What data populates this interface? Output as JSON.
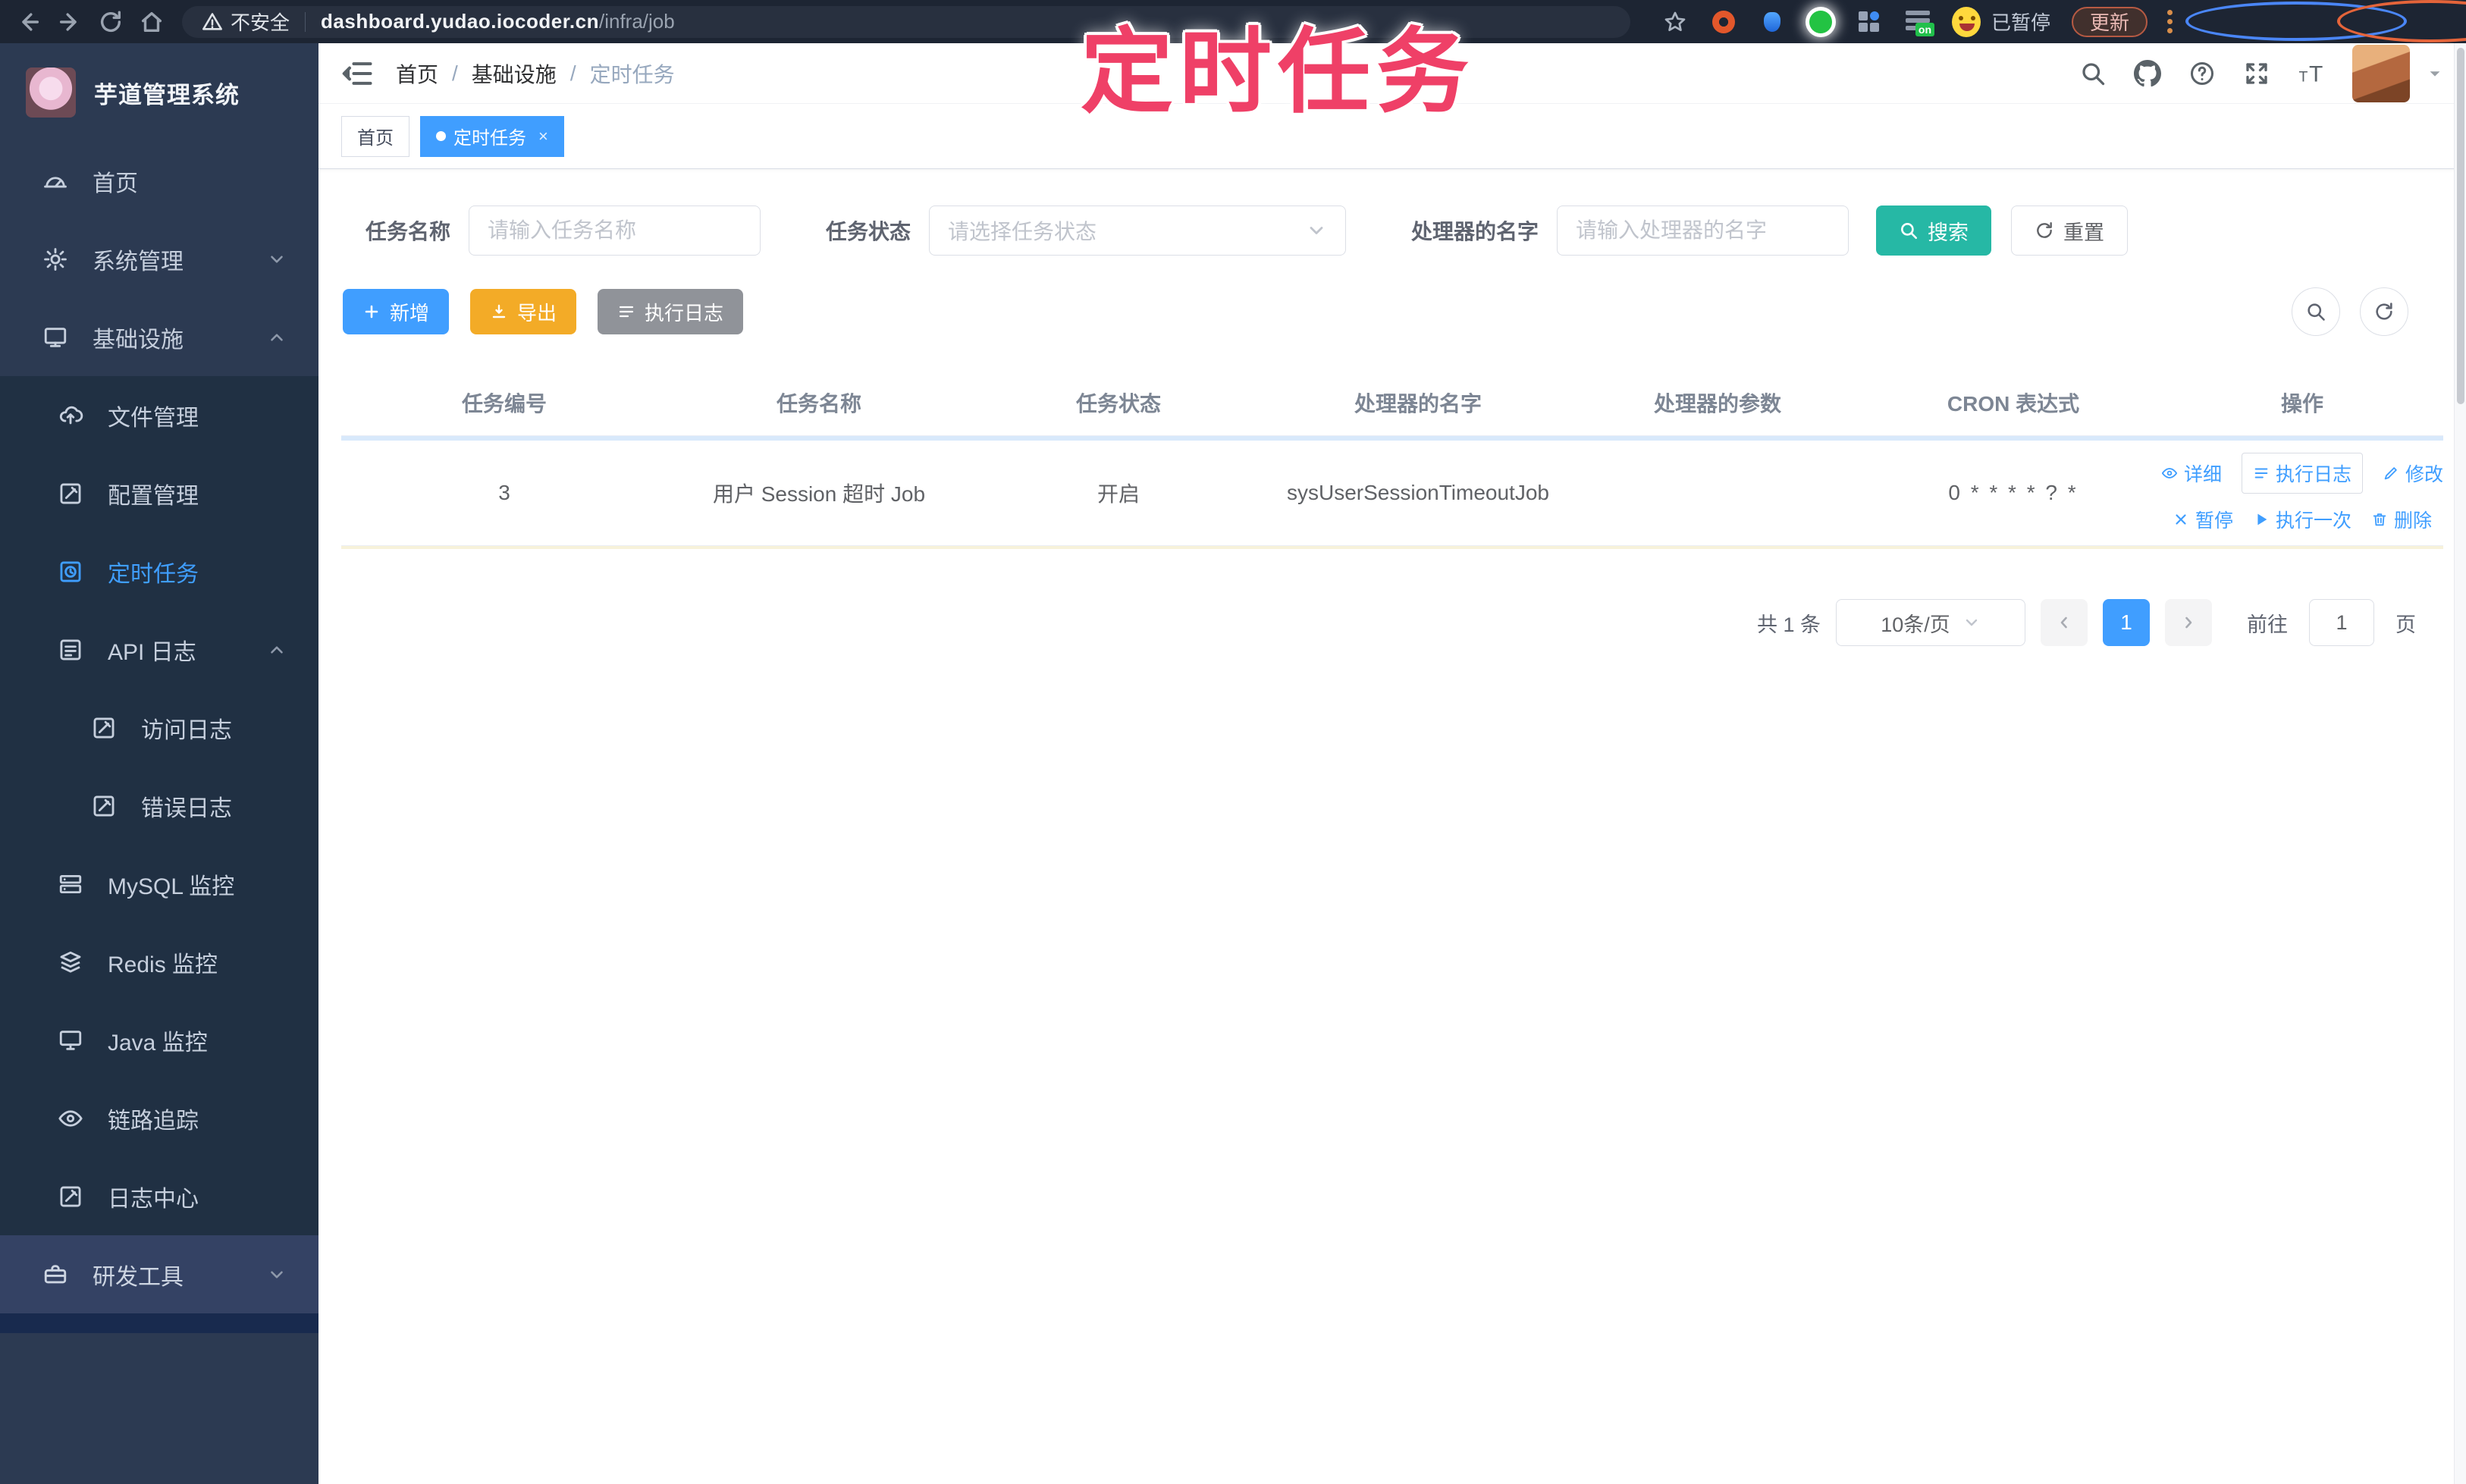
{
  "colors": {
    "accent_blue": "#409eff",
    "search_teal": "#26b8a5",
    "export_orange": "#f3ab27",
    "info_gray": "#909399",
    "sidebar_bg": "#2c3a52",
    "annotation_pink": "#ef4067",
    "annotation_blue": "#4a86f7",
    "annotation_orange": "#e4643a"
  },
  "browser": {
    "security_label": "不安全",
    "url_host": "dashboard.yudao.iocoder.cn",
    "url_path": "/infra/job",
    "paused_label": "已暂停",
    "update_label": "更新"
  },
  "annotation": {
    "title": "定时任务"
  },
  "sidebar": {
    "app_title": "芋道管理系统",
    "items": [
      {
        "label": "首页"
      },
      {
        "label": "系统管理"
      },
      {
        "label": "基础设施"
      },
      {
        "label": "文件管理"
      },
      {
        "label": "配置管理"
      },
      {
        "label": "定时任务"
      },
      {
        "label": "API 日志"
      },
      {
        "label": "访问日志"
      },
      {
        "label": "错误日志"
      },
      {
        "label": "MySQL 监控"
      },
      {
        "label": "Redis 监控"
      },
      {
        "label": "Java 监控"
      },
      {
        "label": "链路追踪"
      },
      {
        "label": "日志中心"
      },
      {
        "label": "研发工具"
      }
    ]
  },
  "header": {
    "breadcrumb": {
      "home": "首页",
      "section": "基础设施",
      "current": "定时任务"
    }
  },
  "tags": {
    "home": "首页",
    "current": "定时任务",
    "close": "×"
  },
  "filters": {
    "name_label": "任务名称",
    "name_placeholder": "请输入任务名称",
    "status_label": "任务状态",
    "status_placeholder": "请选择任务状态",
    "handler_label": "处理器的名字",
    "handler_placeholder": "请输入处理器的名字",
    "search_label": "搜索",
    "reset_label": "重置"
  },
  "toolbar": {
    "add_label": "新增",
    "export_label": "导出",
    "exec_log_label": "执行日志"
  },
  "table": {
    "headers": [
      "任务编号",
      "任务名称",
      "任务状态",
      "处理器的名字",
      "处理器的参数",
      "CRON 表达式",
      "操作"
    ],
    "row": {
      "id": "3",
      "name": "用户 Session 超时 Job",
      "status": "开启",
      "handler": "sysUserSessionTimeoutJob",
      "param": "",
      "cron": "0 * * * * ? *"
    },
    "actions_row1": [
      {
        "label": "详细"
      },
      {
        "label": "执行日志"
      },
      {
        "label": "修改"
      }
    ],
    "actions_row2": [
      {
        "label": "暂停"
      },
      {
        "label": "执行一次"
      },
      {
        "label": "删除"
      }
    ]
  },
  "pagination": {
    "total": "共 1 条",
    "page_size": "10条/页",
    "page": "1",
    "goto_label": "前往",
    "goto_value": "1",
    "unit_label": "页"
  },
  "icons": {
    "back-icon": "left arrow",
    "forward-icon": "right arrow",
    "reload-icon": "circular arrow",
    "home-icon": "house",
    "warning-icon": "triangle exclamation",
    "kebab-menu-icon": "three dots",
    "search-icon": "magnifier",
    "github-icon": "octocat",
    "help-icon": "question circle",
    "fullscreen-icon": "expand arrows",
    "font-size-icon": "tT letters",
    "dashboard-icon": "tachometer",
    "gear-icon": "gear",
    "infra-icon": "monitor",
    "cloud-upload-icon": "cloud with arrow",
    "edit-icon": "square pencil",
    "timer-icon": "square clock",
    "layers-icon": "stacked layers",
    "server-icon": "server boxes",
    "monitor-icon": "desktop",
    "eye-icon": "eye",
    "toolbox-icon": "briefcase",
    "plus-icon": "plus",
    "download-icon": "down arrow bar",
    "list-icon": "list lines",
    "refresh-icon": "circular arrows",
    "pencil-icon": "pencil",
    "close-icon": "cross",
    "play-icon": "triangle",
    "trash-icon": "trash can",
    "chevron-down-icon": "chevron down",
    "chevron-up-icon": "chevron up"
  }
}
